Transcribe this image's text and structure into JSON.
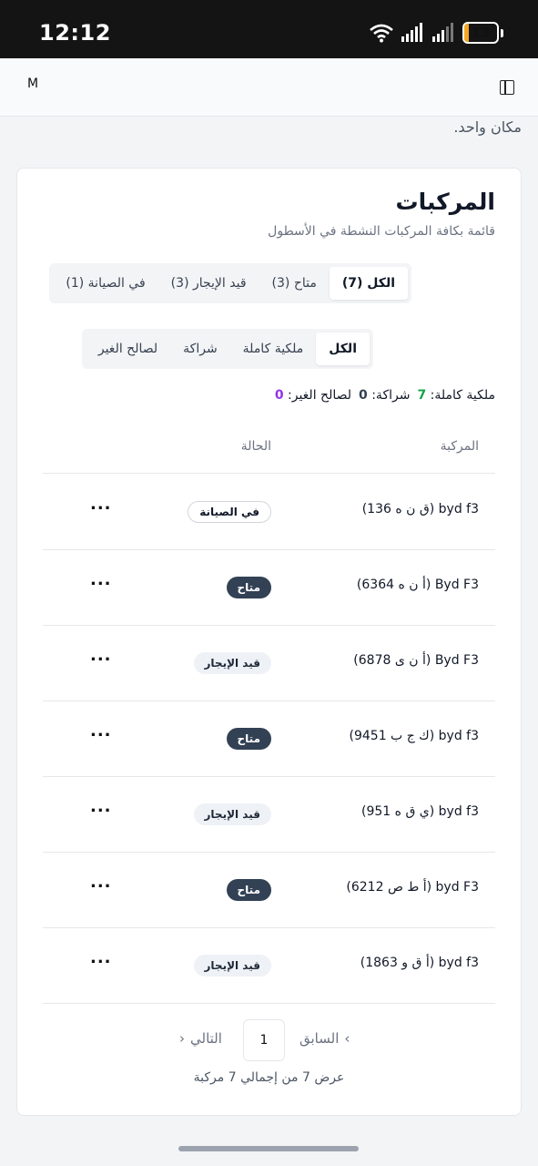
{
  "status_bar": {
    "time": "12:12",
    "battery_level": "13",
    "battery_fraction": 0.13
  },
  "app_bar": {
    "user_initial": "M"
  },
  "peek_text": "مكان واحد.",
  "card": {
    "title": "المركبات",
    "subtitle": "قائمة بكافة المركبات النشطة في الأسطول"
  },
  "status_tabs": [
    {
      "label": "في الصيانة (1)",
      "active": false
    },
    {
      "label": "قيد الإيجار (3)",
      "active": false
    },
    {
      "label": "متاح (3)",
      "active": false
    },
    {
      "label": "الكل (7)",
      "active": true
    }
  ],
  "ownership_tabs": [
    {
      "label": "لصالح الغير",
      "active": false
    },
    {
      "label": "شراكة",
      "active": false
    },
    {
      "label": "ملكية كاملة",
      "active": false
    },
    {
      "label": "الكل",
      "active": true
    }
  ],
  "counts": {
    "full_label": "ملكية كاملة:",
    "full_value": "7",
    "partner_label": "شراكة:",
    "partner_value": "0",
    "third_label": "لصالح الغير:",
    "third_value": "0"
  },
  "table": {
    "columns": {
      "vehicle": "المركبة",
      "status": "الحالة"
    },
    "rows": [
      {
        "name": "byd f3 (ق ن ه 136)",
        "status": "في الصيانة",
        "status_type": "maint",
        "menu": "..."
      },
      {
        "name": "Byd F3 (أ ن ه 6364)",
        "status": "متاح",
        "status_type": "avail",
        "menu": "..."
      },
      {
        "name": "Byd F3 (أ ن ى 6878)",
        "status": "قيد الإيجار",
        "status_type": "rent",
        "menu": "..."
      },
      {
        "name": "byd f3 (ك ج ب 9451)",
        "status": "متاح",
        "status_type": "avail",
        "menu": "..."
      },
      {
        "name": "byd f3 (ي ق ه 951)",
        "status": "قيد الإيجار",
        "status_type": "rent",
        "menu": "..."
      },
      {
        "name": "byd F3 (أ ط ص 6212)",
        "status": "متاح",
        "status_type": "avail",
        "menu": "..."
      },
      {
        "name": "byd f3 (أ ق و 1863)",
        "status": "قيد الإيجار",
        "status_type": "rent",
        "menu": "..."
      }
    ]
  },
  "pagination": {
    "prev_label": "السابق",
    "next_label": "التالي",
    "current_page": "1",
    "summary": "عرض 7 من إجمالي 7 مركبة"
  }
}
